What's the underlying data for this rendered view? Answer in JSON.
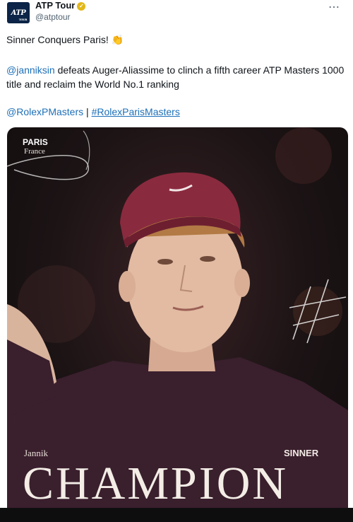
{
  "post": {
    "author_name": "ATP Tour",
    "author_handle": "@atptour",
    "avatar_text": "ATP",
    "avatar_subtext": "TOUR",
    "more_icon": "⋯",
    "verified_icon": "check-badge",
    "headline": "Sinner Conquers Paris!",
    "headline_emoji": "👏",
    "mention": "@janniksin",
    "body": " defeats Auger-Aliassime to clinch a fifth career ATP Masters 1000 title and reclaim the World No.1 ranking",
    "tag1": "@RolexPMasters",
    "separator": " | ",
    "tag2": "#RolexParisMasters"
  },
  "media": {
    "city": "PARIS",
    "country": "France",
    "first_name": "Jannik",
    "last_name": "SINNER",
    "title": "CHAMPION"
  },
  "colors": {
    "link": "#1d6fb8",
    "verified": "#e2b719",
    "cap": "#8a2a3e",
    "shirt": "#3a1f2d"
  }
}
